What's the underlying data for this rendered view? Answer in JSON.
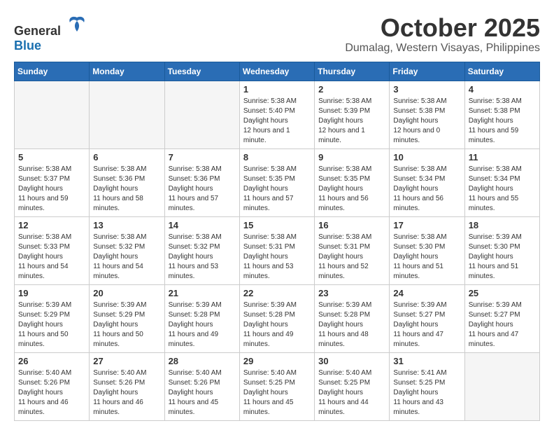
{
  "logo": {
    "general": "General",
    "blue": "Blue"
  },
  "title": "October 2025",
  "location": "Dumalag, Western Visayas, Philippines",
  "days_of_week": [
    "Sunday",
    "Monday",
    "Tuesday",
    "Wednesday",
    "Thursday",
    "Friday",
    "Saturday"
  ],
  "weeks": [
    [
      {
        "day": "",
        "empty": true
      },
      {
        "day": "",
        "empty": true
      },
      {
        "day": "",
        "empty": true
      },
      {
        "day": "1",
        "sunrise": "5:38 AM",
        "sunset": "5:40 PM",
        "daylight": "12 hours and 1 minute."
      },
      {
        "day": "2",
        "sunrise": "5:38 AM",
        "sunset": "5:39 PM",
        "daylight": "12 hours and 1 minute."
      },
      {
        "day": "3",
        "sunrise": "5:38 AM",
        "sunset": "5:38 PM",
        "daylight": "12 hours and 0 minutes."
      },
      {
        "day": "4",
        "sunrise": "5:38 AM",
        "sunset": "5:38 PM",
        "daylight": "11 hours and 59 minutes."
      }
    ],
    [
      {
        "day": "5",
        "sunrise": "5:38 AM",
        "sunset": "5:37 PM",
        "daylight": "11 hours and 59 minutes."
      },
      {
        "day": "6",
        "sunrise": "5:38 AM",
        "sunset": "5:36 PM",
        "daylight": "11 hours and 58 minutes."
      },
      {
        "day": "7",
        "sunrise": "5:38 AM",
        "sunset": "5:36 PM",
        "daylight": "11 hours and 57 minutes."
      },
      {
        "day": "8",
        "sunrise": "5:38 AM",
        "sunset": "5:35 PM",
        "daylight": "11 hours and 57 minutes."
      },
      {
        "day": "9",
        "sunrise": "5:38 AM",
        "sunset": "5:35 PM",
        "daylight": "11 hours and 56 minutes."
      },
      {
        "day": "10",
        "sunrise": "5:38 AM",
        "sunset": "5:34 PM",
        "daylight": "11 hours and 56 minutes."
      },
      {
        "day": "11",
        "sunrise": "5:38 AM",
        "sunset": "5:34 PM",
        "daylight": "11 hours and 55 minutes."
      }
    ],
    [
      {
        "day": "12",
        "sunrise": "5:38 AM",
        "sunset": "5:33 PM",
        "daylight": "11 hours and 54 minutes."
      },
      {
        "day": "13",
        "sunrise": "5:38 AM",
        "sunset": "5:32 PM",
        "daylight": "11 hours and 54 minutes."
      },
      {
        "day": "14",
        "sunrise": "5:38 AM",
        "sunset": "5:32 PM",
        "daylight": "11 hours and 53 minutes."
      },
      {
        "day": "15",
        "sunrise": "5:38 AM",
        "sunset": "5:31 PM",
        "daylight": "11 hours and 53 minutes."
      },
      {
        "day": "16",
        "sunrise": "5:38 AM",
        "sunset": "5:31 PM",
        "daylight": "11 hours and 52 minutes."
      },
      {
        "day": "17",
        "sunrise": "5:38 AM",
        "sunset": "5:30 PM",
        "daylight": "11 hours and 51 minutes."
      },
      {
        "day": "18",
        "sunrise": "5:39 AM",
        "sunset": "5:30 PM",
        "daylight": "11 hours and 51 minutes."
      }
    ],
    [
      {
        "day": "19",
        "sunrise": "5:39 AM",
        "sunset": "5:29 PM",
        "daylight": "11 hours and 50 minutes."
      },
      {
        "day": "20",
        "sunrise": "5:39 AM",
        "sunset": "5:29 PM",
        "daylight": "11 hours and 50 minutes."
      },
      {
        "day": "21",
        "sunrise": "5:39 AM",
        "sunset": "5:28 PM",
        "daylight": "11 hours and 49 minutes."
      },
      {
        "day": "22",
        "sunrise": "5:39 AM",
        "sunset": "5:28 PM",
        "daylight": "11 hours and 49 minutes."
      },
      {
        "day": "23",
        "sunrise": "5:39 AM",
        "sunset": "5:28 PM",
        "daylight": "11 hours and 48 minutes."
      },
      {
        "day": "24",
        "sunrise": "5:39 AM",
        "sunset": "5:27 PM",
        "daylight": "11 hours and 47 minutes."
      },
      {
        "day": "25",
        "sunrise": "5:39 AM",
        "sunset": "5:27 PM",
        "daylight": "11 hours and 47 minutes."
      }
    ],
    [
      {
        "day": "26",
        "sunrise": "5:40 AM",
        "sunset": "5:26 PM",
        "daylight": "11 hours and 46 minutes."
      },
      {
        "day": "27",
        "sunrise": "5:40 AM",
        "sunset": "5:26 PM",
        "daylight": "11 hours and 46 minutes."
      },
      {
        "day": "28",
        "sunrise": "5:40 AM",
        "sunset": "5:26 PM",
        "daylight": "11 hours and 45 minutes."
      },
      {
        "day": "29",
        "sunrise": "5:40 AM",
        "sunset": "5:25 PM",
        "daylight": "11 hours and 45 minutes."
      },
      {
        "day": "30",
        "sunrise": "5:40 AM",
        "sunset": "5:25 PM",
        "daylight": "11 hours and 44 minutes."
      },
      {
        "day": "31",
        "sunrise": "5:41 AM",
        "sunset": "5:25 PM",
        "daylight": "11 hours and 43 minutes."
      },
      {
        "day": "",
        "empty": true
      }
    ]
  ]
}
